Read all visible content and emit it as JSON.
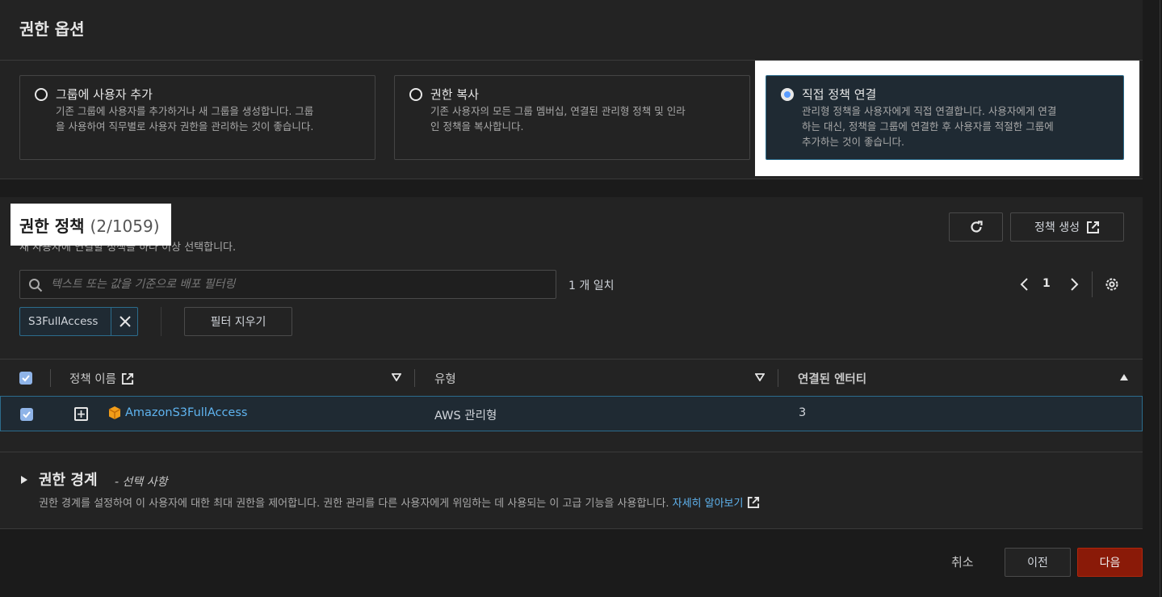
{
  "permission_options": {
    "title": "권한 옵션",
    "options": [
      {
        "label": "그룹에 사용자 추가",
        "description_lines": [
          "기존 그룹에 사용자를 추가하거나 새 그룹을 생성합니다. 그룹",
          "을 사용하여 직무별로 사용자 권한을 관리하는 것이 좋습니다."
        ],
        "selected": false
      },
      {
        "label": "권한 복사",
        "description_lines": [
          "기존 사용자의 모든 그룹 멤버십, 연결된 관리형 정책 및 인라",
          "인 정책을 복사합니다."
        ],
        "selected": false
      },
      {
        "label": "직접 정책 연결",
        "description_lines": [
          "관리형 정책을 사용자에게 직접 연결합니다. 사용자에게 연결",
          "하는 대신, 정책을 그룹에 연결한 후 사용자를 적절한 그룹에",
          "추가하는 것이 좋습니다."
        ],
        "selected": true
      }
    ]
  },
  "policies": {
    "title": "권한 정책",
    "count": "(2/1059)",
    "subtitle": "새 사용자에 연결할 정책을 하나 이상 선택합니다.",
    "create_button": "정책 생성",
    "search": {
      "placeholder": "텍스트 또는 값을 기준으로 배포 필터링",
      "value": ""
    },
    "match_count": "1 개 일치",
    "pagination": {
      "current_page": "1"
    },
    "filter_token": "S3FullAccess",
    "clear_filter_button": "필터 지우기",
    "table": {
      "columns": [
        "정책 이름",
        "유형",
        "연결된 엔터티"
      ],
      "rows": [
        {
          "name": "AmazonS3FullAccess",
          "type": "AWS 관리형",
          "attached_entities": "3",
          "checked": true
        }
      ]
    }
  },
  "permission_boundary": {
    "title": "권한 경계",
    "optional": "- 선택 사항",
    "description": "권한 경계를 설정하여 이 사용자에 대한 최대 권한을 제어합니다. 권한 관리를 다른 사용자에게 위임하는 데 사용되는 이 고급 기능을 사용합니다.",
    "learn_more": "자세히 알아보기"
  },
  "footer": {
    "cancel": "취소",
    "previous": "이전",
    "next": "다음"
  },
  "colors": {
    "link": "#5fb4f0",
    "selected_border": "#2c6c8c",
    "primary_button": "#8a1a08"
  }
}
